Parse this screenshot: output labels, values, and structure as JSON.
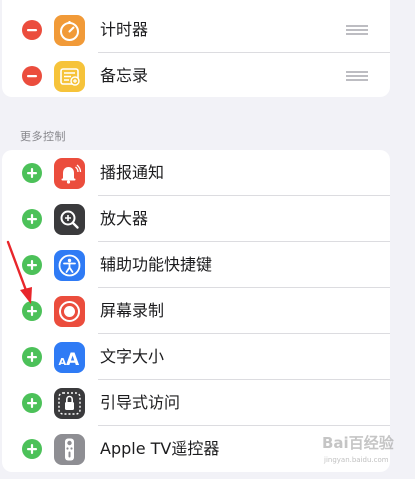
{
  "included_controls": [
    {
      "label": "计时器",
      "action": "remove",
      "icon": "timer-icon",
      "icon_color": "#f19a38"
    },
    {
      "label": "备忘录",
      "action": "remove",
      "icon": "notes-icon",
      "icon_color": "#f6c33a"
    }
  ],
  "more_controls": {
    "header": "更多控制",
    "items": [
      {
        "label": "播报通知",
        "action": "add",
        "icon": "announce-notifications-icon",
        "icon_color": "#eb4d3d"
      },
      {
        "label": "放大器",
        "action": "add",
        "icon": "magnifier-icon",
        "icon_color": "#3a3a3c"
      },
      {
        "label": "辅助功能快捷键",
        "action": "add",
        "icon": "accessibility-icon",
        "icon_color": "#2f7bf5"
      },
      {
        "label": "屏幕录制",
        "action": "add",
        "icon": "screen-recording-icon",
        "icon_color": "#eb4d3d"
      },
      {
        "label": "文字大小",
        "action": "add",
        "icon": "text-size-icon",
        "icon_color": "#2f7bf5"
      },
      {
        "label": "引导式访问",
        "action": "add",
        "icon": "guided-access-icon",
        "icon_color": "#3a3a3c"
      },
      {
        "label": "Apple TV遥控器",
        "action": "add",
        "icon": "apple-tv-remote-icon",
        "icon_color": "#8e8e93"
      }
    ]
  },
  "colors": {
    "remove": "#eb4d3d",
    "add": "#4cc159",
    "arrow": "#e8262b"
  },
  "watermark": {
    "text": "Bai百经验",
    "sub": "jingyan.baidu.com"
  }
}
